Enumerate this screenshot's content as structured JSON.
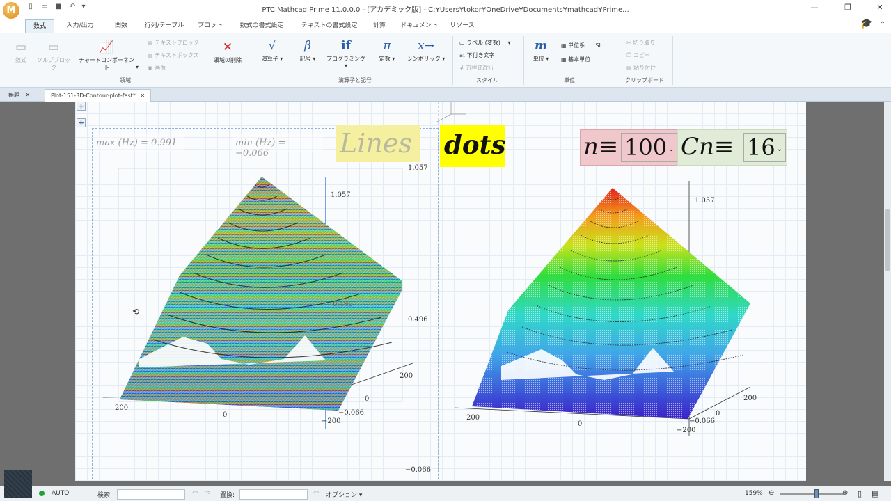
{
  "app": {
    "title": "PTC Mathcad Prime 11.0.0.0 - [アカデミック版] - C:¥Users¥tokor¥OneDrive¥Documents¥mathcad¥Prime...",
    "logo_letter": "M"
  },
  "ribbon_tabs": [
    "数式",
    "入力/出力",
    "関数",
    "行列/テーブル",
    "プロット",
    "数式の書式設定",
    "テキストの書式設定",
    "計算",
    "ドキュメント",
    "リソース"
  ],
  "ribbon": {
    "region_group": {
      "label": "領域",
      "buttons": [
        "数式",
        "ソルブブロック",
        "チャートコンポーネント",
        "領域の削除"
      ],
      "small": [
        "テキストブロック",
        "テキストボックス",
        "画像"
      ]
    },
    "operators_group": {
      "label": "演算子と記号",
      "buttons": [
        "演算子",
        "記号",
        "プログラミング",
        "定数",
        "シンボリック"
      ]
    },
    "style_group": {
      "label": "スタイル",
      "items": [
        "ラベル",
        "(変数)",
        "下付き文字",
        "方程式改行"
      ]
    },
    "units_group": {
      "label": "単位",
      "buttons": [
        "単位"
      ],
      "unit_system_label": "単位系:",
      "unit_system_value": "SI",
      "base_units": "基本単位"
    },
    "clipboard_group": {
      "label": "クリップボード",
      "items": [
        "切り取り",
        "コピー",
        "貼り付け"
      ]
    }
  },
  "doc_tabs": [
    "無題",
    "Plot-151-3D-Contour-plot-fast*"
  ],
  "worksheet": {
    "max_label": "max (Hz) = 0.991",
    "min_label": "min (Hz) = −0.066",
    "lines_label": "Lines",
    "dots_label": "dots",
    "n_def": "n≡",
    "n_value": "100",
    "cn_def": "Cn≡",
    "cn_value": "16",
    "left_plot": {
      "z_top": "1.057",
      "z_mid": "0.496",
      "x_200": "200",
      "x_0": "0",
      "y_200": "200",
      "y_0": "0",
      "y_neg200": "−200",
      "z_neg": "−0.066",
      "side_top": "1.057",
      "side_mid": "0.496",
      "side_bottom": "−0.066"
    },
    "right_plot": {
      "z_top": "1.057",
      "x_200": "200",
      "x_0": "0",
      "y_200": "200",
      "y_0": "0",
      "y_neg200": "−200",
      "z_neg": "−0.066"
    }
  },
  "status_bar": {
    "calc_mode": "AUTO",
    "search_label": "検索:",
    "replace_label": "置換:",
    "options_label": "オプション",
    "zoom": "159%"
  },
  "colors": {
    "accent": "#1e6fc4",
    "lines_highlight": "#f5f0a0",
    "dots_highlight": "#ffff00",
    "n_box": "#f0c8cc",
    "cn_box": "#e1ecd8"
  }
}
